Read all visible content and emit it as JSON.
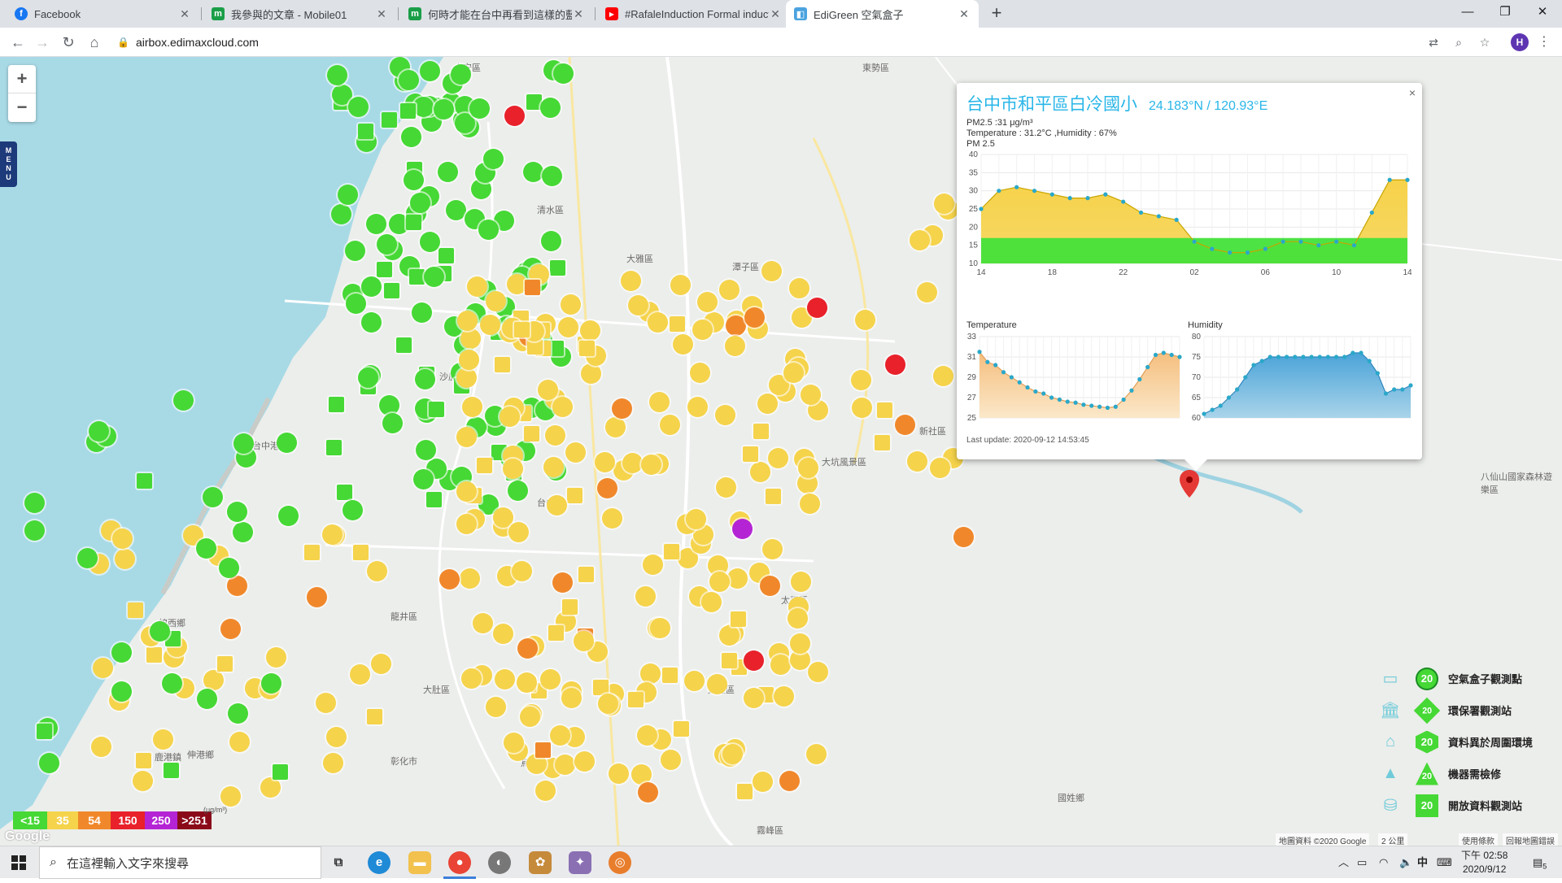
{
  "browser": {
    "tabs": [
      {
        "label": "Facebook",
        "icon": "facebook-icon",
        "color": "#1877f2",
        "glyph": "f"
      },
      {
        "label": "我參與的文章 - Mobile01",
        "icon": "mobile01-icon",
        "color": "#1a9e48",
        "glyph": "m"
      },
      {
        "label": "何時才能在台中再看到這樣的藍天",
        "icon": "mobile01-icon",
        "color": "#1a9e48",
        "glyph": "m"
      },
      {
        "label": "#RafaleInduction Formal induction",
        "icon": "youtube-icon",
        "color": "#ff0000",
        "glyph": "▶"
      },
      {
        "label": "EdiGreen 空氣盒子",
        "icon": "edigreen-icon",
        "color": "#4aa3df",
        "glyph": "◧"
      }
    ],
    "url": "airbox.edimaxcloud.com",
    "profile_initial": "H"
  },
  "map": {
    "zoom_in": "+",
    "zoom_out": "−",
    "menu_label": "M E N U",
    "place_labels": [
      "大安區",
      "清水區",
      "沙鹿區",
      "龍井區",
      "台中市",
      "大肚區",
      "烏日區",
      "彰化市",
      "大雅區",
      "潭子區",
      "太平區",
      "大里區",
      "霧峰區",
      "新社區",
      "東勢區",
      "國姓鄉",
      "大坑風景區",
      "八仙山國家森林遊樂區",
      "台中港",
      "鹿港鎮",
      "線西鄉",
      "伸港鄉"
    ],
    "colors": {
      "green": "#46d835",
      "yellow": "#f5d34b",
      "orange": "#f0882b",
      "red": "#e8212b",
      "purple": "#b424d4",
      "darkred": "#8b0a1a"
    }
  },
  "popup": {
    "title": "台中市和平區白冷國小",
    "coord": "24.183°N / 120.93°E",
    "pm25_line": "PM2.5 :31 μg/m³",
    "temp_humidity_line": "Temperature : 31.2°C ,Humidity : 67%",
    "pm_chart_label": "PM 2.5",
    "temp_label": "Temperature",
    "humidity_label": "Humidity",
    "last_update": "Last update: 2020-09-12 14:53:45",
    "close": "×"
  },
  "chart_data": [
    {
      "type": "area",
      "title": "PM 2.5",
      "x": [
        "14",
        "15",
        "16",
        "17",
        "18",
        "19",
        "20",
        "21",
        "22",
        "23",
        "00",
        "01",
        "02",
        "03",
        "04",
        "05",
        "06",
        "07",
        "08",
        "09",
        "10",
        "11",
        "12",
        "13",
        "14"
      ],
      "xticks": [
        "14",
        "18",
        "22",
        "02",
        "06",
        "10",
        "14"
      ],
      "values": [
        25,
        30,
        31,
        30,
        29,
        28,
        28,
        29,
        27,
        24,
        23,
        22,
        16,
        14,
        13,
        13,
        14,
        16,
        16,
        15,
        16,
        15,
        24,
        33,
        33
      ],
      "ylim": [
        10,
        40
      ],
      "yticks": [
        10,
        15,
        20,
        25,
        30,
        35,
        40
      ]
    },
    {
      "type": "area",
      "title": "Temperature",
      "values": [
        31.5,
        30.5,
        30.2,
        29.5,
        29,
        28.5,
        28,
        27.6,
        27.4,
        27,
        26.8,
        26.6,
        26.5,
        26.3,
        26.2,
        26.1,
        26,
        26.1,
        26.8,
        27.7,
        28.8,
        30,
        31.2,
        31.4,
        31.2,
        31
      ],
      "ylim": [
        25,
        33
      ],
      "yticks": [
        25,
        27,
        29,
        31,
        33
      ]
    },
    {
      "type": "area",
      "title": "Humidity",
      "values": [
        61,
        62,
        63,
        65,
        67,
        70,
        73,
        74,
        75,
        75,
        75,
        75,
        75,
        75,
        75,
        75,
        75,
        75,
        76,
        76,
        74,
        71,
        66,
        67,
        67,
        68
      ],
      "ylim": [
        60,
        80
      ],
      "yticks": [
        60,
        65,
        70,
        75,
        80
      ]
    }
  ],
  "legend": [
    {
      "label": "空氣盒子觀測點",
      "icon": "airbox-icon",
      "shape": "circle",
      "value": "20"
    },
    {
      "label": "環保署觀測站",
      "icon": "government-building-icon",
      "shape": "diamond",
      "value": "20"
    },
    {
      "label": "資料異於周圍環境",
      "icon": "house-icon",
      "shape": "hex",
      "value": "20"
    },
    {
      "label": "機器需檢修",
      "icon": "cone-icon",
      "shape": "tri",
      "value": "20"
    },
    {
      "label": "開放資料觀測站",
      "icon": "open-data-icon",
      "shape": "square",
      "value": "20"
    }
  ],
  "aqi_scale": [
    {
      "label": "<15",
      "color": "#46d835"
    },
    {
      "label": "35",
      "color": "#f5d34b"
    },
    {
      "label": "54",
      "color": "#f0882b"
    },
    {
      "label": "150",
      "color": "#e8212b"
    },
    {
      "label": "250",
      "color": "#b424d4"
    },
    {
      "label": ">251",
      "color": "#8b0a1a"
    }
  ],
  "aqi_unit": "(μg/m³)",
  "attribution": {
    "google": "Google",
    "map_data": "地圖資料 ©2020 Google",
    "scale": "2 公里",
    "terms": "使用條款",
    "report": "回報地圖錯誤"
  },
  "taskbar": {
    "search_placeholder": "在這裡輸入文字來搜尋",
    "time": "下午 02:58",
    "date": "2020/9/12",
    "ime": "中",
    "notifications": "5"
  }
}
